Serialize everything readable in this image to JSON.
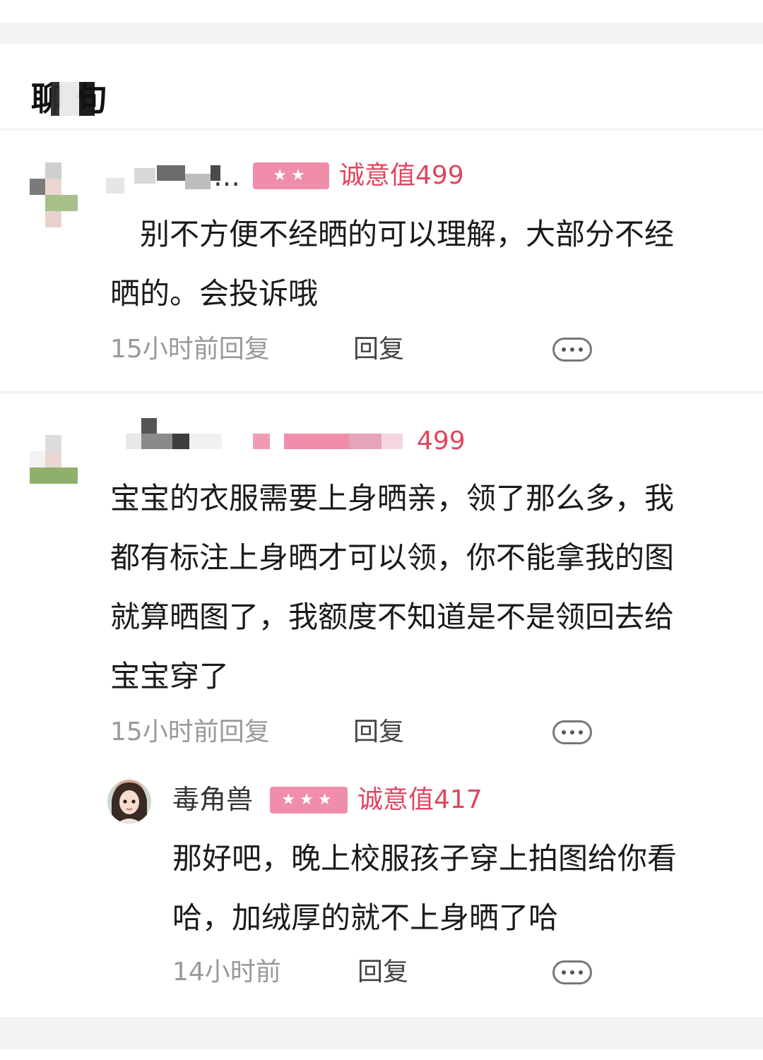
{
  "section": {
    "title": "聊 句"
  },
  "comments": [
    {
      "username": "…",
      "level_badge": "★★",
      "sincerity": "诚意值499",
      "text_line1": "别不方便不经晒的可以理解，大部分不经",
      "text_line2": "晒的。会投诉哦",
      "time": "15小时前回复",
      "reply": "回复"
    },
    {
      "sincerity": "499",
      "text_line1": "宝宝的衣服需要上身晒亲，领了那么多，我",
      "text_line2": "都有标注上身晒才可以领，你不能拿我的图",
      "text_line3": "就算晒图了，我额度不知道是不是领回去给",
      "text_line4": "宝宝穿了",
      "time": "15小时前回复",
      "reply": "回复"
    },
    {
      "username": "毒角兽",
      "level_badge": "★★★",
      "sincerity": "诚意值417",
      "text_line1": "那好吧，晚上校服孩子穿上拍图给你看",
      "text_line2": "哈，加绒厚的就不上身晒了哈",
      "time": "14小时前",
      "reply": "回复"
    }
  ],
  "icons": {
    "more": "more-options-icon"
  },
  "colors": {
    "accent_pink": "#f08eaa",
    "sincerity_red": "#e0455f",
    "muted_text": "#999999"
  }
}
